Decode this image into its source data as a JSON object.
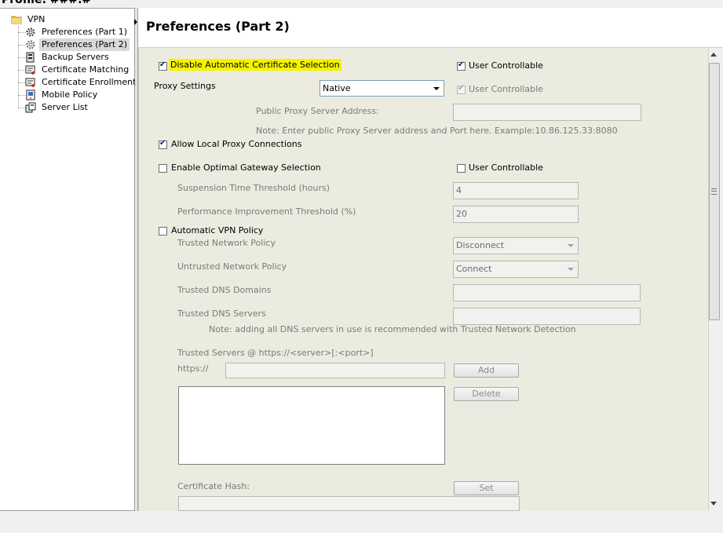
{
  "window": {
    "title": "Profile: ###.#"
  },
  "tree": {
    "root": {
      "label": "VPN",
      "icon": "folder-icon"
    },
    "items": [
      {
        "label": "Preferences (Part 1)",
        "icon": "gear-icon",
        "selected": false
      },
      {
        "label": "Preferences (Part 2)",
        "icon": "gear-icon",
        "selected": true
      },
      {
        "label": "Backup Servers",
        "icon": "server-icon",
        "selected": false
      },
      {
        "label": "Certificate Matching",
        "icon": "certificate-icon",
        "selected": false
      },
      {
        "label": "Certificate Enrollment",
        "icon": "certificate-icon",
        "selected": false
      },
      {
        "label": "Mobile Policy",
        "icon": "mobile-icon",
        "selected": false
      },
      {
        "label": "Server List",
        "icon": "server-list-icon",
        "selected": false
      }
    ]
  },
  "header": {
    "title": "Preferences (Part 2)"
  },
  "form": {
    "disable_auto_cert": {
      "label": "Disable Automatic Certificate Selection",
      "checked": true
    },
    "uc1": {
      "label": "User Controllable",
      "checked": true
    },
    "proxy_settings": {
      "label": "Proxy Settings",
      "value": "Native"
    },
    "uc2": {
      "label": "User Controllable",
      "checked": true,
      "disabled": true
    },
    "public_proxy": {
      "label": "Public Proxy Server Address:",
      "value": "",
      "note": "Note: Enter public Proxy Server address and Port here. Example:10.86.125.33:8080"
    },
    "allow_local_proxy": {
      "label": "Allow Local Proxy Connections",
      "checked": true
    },
    "optimal_gateway": {
      "label": "Enable Optimal Gateway Selection",
      "checked": false
    },
    "uc3": {
      "label": "User Controllable",
      "checked": false
    },
    "suspension": {
      "label": "Suspension Time Threshold (hours)",
      "value": "4"
    },
    "performance": {
      "label": "Performance Improvement Threshold (%)",
      "value": "20"
    },
    "auto_vpn": {
      "label": "Automatic VPN Policy",
      "checked": false
    },
    "trusted_network": {
      "label": "Trusted Network Policy",
      "value": "Disconnect"
    },
    "untrusted_network": {
      "label": "Untrusted Network Policy",
      "value": "Connect"
    },
    "trusted_dns_domains": {
      "label": "Trusted DNS Domains",
      "value": ""
    },
    "trusted_dns_servers": {
      "label": "Trusted DNS Servers",
      "value": ""
    },
    "dns_note": "Note: adding all DNS servers in use is recommended with Trusted Network Detection",
    "trusted_servers": {
      "label": "Trusted Servers @ https://<server>[:<port>]",
      "prefix": "https://",
      "value": ""
    },
    "add_button": "Add",
    "delete_button": "Delete",
    "cert_hash": {
      "label": "Certificate Hash:",
      "value": ""
    },
    "set_button": "Set"
  }
}
